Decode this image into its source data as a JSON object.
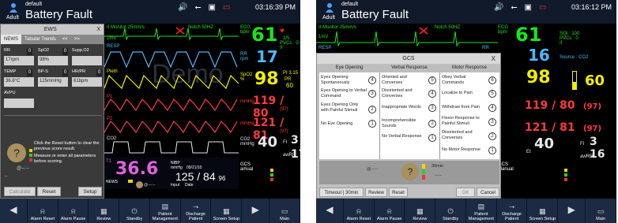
{
  "colors": {
    "ecg": "#19e619",
    "spo2": "#f0f000",
    "p1": "#ff3a3a",
    "p2": "#ff3a3a",
    "co2": "#e8e8e8",
    "resp": "#4ab8ff",
    "temp": "#e060e0",
    "alarm_red": "#ff2020"
  },
  "left": {
    "header": {
      "bed": "default",
      "patient_type": "Adult",
      "title": "Battery Fault",
      "clock": "03:16:39 PM"
    },
    "waves": {
      "ecg_lead": "II",
      "ecg_mode": "Monitor",
      "ecg_speed": "25mm/s",
      "notch": "Notch 50HZ",
      "scale": "1mV",
      "resp": "RESP",
      "pleth": "Pleth",
      "p1": "P1",
      "p2": "P2",
      "co2": "CO2",
      "demo": "Demo"
    },
    "params": {
      "ecg_label": "ECG",
      "ecg_unit": "bpm",
      "hr": "61",
      "hr_small": "1/5",
      "pvc": "PVCs : 0",
      "st": "II",
      "rr_label": "RR",
      "rr_unit": "rpm",
      "rr": "17",
      "spo2_label": "SpO2",
      "spo2_unit": "%",
      "spo2": "98",
      "pi": "PI 3.15",
      "pr_label": "PR",
      "pr": "60",
      "p1_unit": "mmHg",
      "p1": "119 / 80",
      "p1_mean": "(97)",
      "p2_unit": "mmHg",
      "p2": "121 / 81",
      "p2_mean": "(97)",
      "co2_label": "CO2",
      "co2_unit": "mmHg",
      "co2": "40",
      "fi": "FI",
      "fi_val": "3",
      "awrr": "awRR",
      "awrr_val": "17",
      "gcs": "GCS",
      "gcs_manual": "amual"
    },
    "bottom_strip": {
      "t1": "T1",
      "temp": "36.6",
      "nibp": "NIBP",
      "nibp_unit": "mmHg",
      "nibp_time": "09/21/10",
      "nibp_sys": "125",
      "nibp_dia": "84",
      "nibp_mean": "96",
      "news": "NEWS",
      "input": "Input",
      "date": "Date",
      "time_dash": "@---:--"
    },
    "ews": {
      "title": "EWS",
      "close": "X",
      "tabs": [
        "NEWS",
        "Tabular Trends",
        "<<",
        ">>"
      ],
      "fields": [
        {
          "label": "RR",
          "value": "17rpm",
          "score": "0"
        },
        {
          "label": "SpO2",
          "value": "98%",
          "score": "0"
        },
        {
          "label": "Supp.O2",
          "value": "",
          "score": ""
        },
        {
          "label": "TEMP",
          "value": "36.6°C",
          "score": "0"
        },
        {
          "label": "BP-S",
          "value": "125mmHg",
          "score": "0"
        },
        {
          "label": "HR/PR",
          "value": "61bpm",
          "score": "0"
        },
        {
          "label": "AVPU",
          "value": "",
          "score": ""
        }
      ],
      "q": "?",
      "msg1": "Click the Reset button to clear the previous score result.",
      "msg2": "Measure or enter all parameters before scoring.",
      "time": "@--:--",
      "dashes": "--",
      "calculate": "Calculate",
      "reset": "Reset",
      "setup": "Setup"
    }
  },
  "right": {
    "header": {
      "bed": "default",
      "patient_type": "Adult",
      "title": "Battery Fault",
      "clock": "03:16:12 PM"
    },
    "params": {
      "hr": "61",
      "sq": "SQI : 100",
      "pvc": "PVCs : 0",
      "st": "II",
      "rr": "16",
      "source": "Source : CO2",
      "spo2": "98",
      "pr": "60",
      "p1": "119 / 80",
      "p1_mean": "(97)",
      "p2": "121 / 81",
      "p2_mean": "(97)",
      "co2": "40",
      "fi_val": "3",
      "awrr_val": "16",
      "gcs": "GCS",
      "gcs_manual": "Manual",
      "et": "Et"
    },
    "gcs": {
      "title": "GCS",
      "close": "X",
      "columns": [
        "Eye Opening",
        "Verbal Response",
        "Motor Response"
      ],
      "eye": [
        {
          "label": "Eyes Opening Spontaneously",
          "score": "4"
        },
        {
          "label": "Eyes Opening to Verbal Command",
          "score": "3"
        },
        {
          "label": "Eyes Opening Only with Painful Stimuli",
          "score": "2"
        },
        {
          "label": "No Eye Opening",
          "score": "1"
        }
      ],
      "verbal": [
        {
          "label": "Oriented and Converses",
          "score": "5"
        },
        {
          "label": "Disoriented and Converses",
          "score": "4"
        },
        {
          "label": "Inappropriate Words",
          "score": "3"
        },
        {
          "label": "Incomprehensible Sounds",
          "score": "2"
        },
        {
          "label": "No Verbal Response",
          "score": "1"
        }
      ],
      "motor": [
        {
          "label": "Obey Verbal Commands",
          "score": "6"
        },
        {
          "label": "Localize to Pain",
          "score": "5"
        },
        {
          "label": "Withdraw from Pain",
          "score": "4"
        },
        {
          "label": "Flexor Response to Painful Stimuli",
          "score": "3"
        },
        {
          "label": "Disoriented and Converses",
          "score": "2"
        },
        {
          "label": "No Motor Response",
          "score": "1"
        }
      ],
      "q": "?",
      "time": "@--:--",
      "interval": "30min",
      "dashes": "--:--",
      "timeout": "Timeout | 30min",
      "review": "Review",
      "reset": "Reset",
      "ok": "OK",
      "cancel": "Cancel"
    }
  },
  "bottom_bar": {
    "buttons": [
      {
        "label": "",
        "icon": "arrow-left-icon"
      },
      {
        "label": "Alarm Reset",
        "icon": "alarm-reset-icon"
      },
      {
        "label": "Alarm Pause",
        "icon": "alarm-pause-icon"
      },
      {
        "label": "Review",
        "icon": "review-icon"
      },
      {
        "label": "Standby",
        "icon": "standby-icon"
      },
      {
        "label": "Patient Management",
        "icon": "patient-icon"
      },
      {
        "label": "Discharge Patient",
        "icon": "discharge-icon"
      },
      {
        "label": "Screen Setup",
        "icon": "screen-setup-icon"
      },
      {
        "label": "",
        "icon": "arrow-right-icon"
      },
      {
        "label": "Main",
        "icon": "main-icon"
      }
    ]
  }
}
